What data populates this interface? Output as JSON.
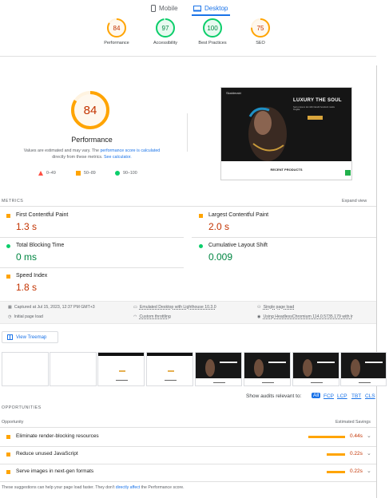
{
  "tabs": {
    "mobile": "Mobile",
    "desktop": "Desktop"
  },
  "scores": [
    {
      "value": "84",
      "label": "Performance",
      "color": "#ffa400",
      "fill": 0.84
    },
    {
      "value": "97",
      "label": "Accessibility",
      "color": "#0cce6b",
      "fill": 0.97
    },
    {
      "value": "100",
      "label": "Best Practices",
      "color": "#0cce6b",
      "fill": 1.0
    },
    {
      "value": "75",
      "label": "SEO",
      "color": "#ffa400",
      "fill": 0.75
    }
  ],
  "perf": {
    "score": "84",
    "fill": 0.84,
    "title": "Performance",
    "note_a": "Values are estimated and may vary. The ",
    "note_link1": "performance score is calculated",
    "note_b": "directly from these metrics. ",
    "note_link2": "See calculator.",
    "legend": [
      "0–49",
      "50–89",
      "90–100"
    ]
  },
  "site": {
    "brand": "Skaldmakt",
    "hero_title": "LUXURY THE SOUL",
    "hero_text": "Sed ut ipsum dui nibh blandit hendrerit mattis fringilla.",
    "hero_btn": "",
    "section": "RECENT PRODUCTS"
  },
  "metrics": {
    "title": "METRICS",
    "expand": "Expand view",
    "items": [
      {
        "name": "First Contentful Paint",
        "value": "1.3 s",
        "status": "average"
      },
      {
        "name": "Largest Contentful Paint",
        "value": "2.0 s",
        "status": "average"
      },
      {
        "name": "Total Blocking Time",
        "value": "0 ms",
        "status": "good"
      },
      {
        "name": "Cumulative Layout Shift",
        "value": "0.009",
        "status": "good"
      },
      {
        "name": "Speed Index",
        "value": "1.8 s",
        "status": "average"
      }
    ]
  },
  "runinfo": {
    "captured": "Captured at Jul 15, 2023, 12:37 PM GMT+3",
    "emulated": "Emulated Desktop with Lighthouse 10.3.0",
    "single": "Single page load",
    "initial": "Initial page load",
    "throttling": "Custom throttling",
    "browser": "Using HeadlessChromium 114.0.5735.179 with lr"
  },
  "treemap": "View Treemap",
  "filter": {
    "label": "Show audits relevant to:",
    "options": [
      "All",
      "FCP",
      "LCP",
      "TBT",
      "CLS"
    ]
  },
  "opportunities": {
    "title": "OPPORTUNITIES",
    "col1": "Opportunity",
    "col2": "Estimated Savings",
    "items": [
      {
        "name": "Eliminate render-blocking resources",
        "value": "0.44s",
        "bar": 0.44
      },
      {
        "name": "Reduce unused JavaScript",
        "value": "0.22s",
        "bar": 0.22
      },
      {
        "name": "Serve images in next-gen formats",
        "value": "0.22s",
        "bar": 0.22
      }
    ]
  },
  "footer": {
    "text": "These suggestions can help your page load faster. They don't ",
    "link": "directly affect",
    "text2": " the Performance score."
  }
}
